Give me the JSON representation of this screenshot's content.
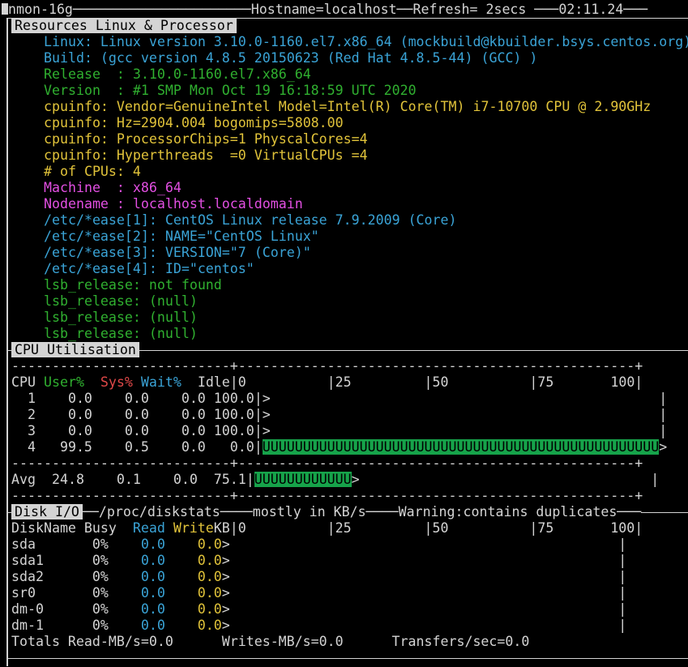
{
  "titlebar": {
    "app": "nmon-16g",
    "hostname": "Hostname=localhost",
    "refresh": "Refresh= 2secs",
    "clock": "02:11.24"
  },
  "resources": {
    "title": "Resources Linux & Processor",
    "linux": "Linux: Linux version 3.10.0-1160.el7.x86_64 (mockbuild@kbuilder.bsys.centos.org)",
    "build": "Build: (gcc version 4.8.5 20150623 (Red Hat 4.8.5-44) (GCC) )",
    "release": "Release  : 3.10.0-1160.el7.x86_64",
    "version": "Version  : #1 SMP Mon Oct 19 16:18:59 UTC 2020",
    "cpuinfo1": "cpuinfo: Vendor=GenuineIntel Model=Intel(R) Core(TM) i7-10700 CPU @ 2.90GHz",
    "cpuinfo2": "cpuinfo: Hz=2904.004 bogomips=5808.00",
    "cpuinfo3": "cpuinfo: ProcessorChips=1 PhyscalCores=4",
    "cpuinfo4": "cpuinfo: Hyperthreads  =0 VirtualCPUs =4",
    "ncpus": "# of CPUs: 4",
    "machine": "Machine  : x86_64",
    "nodename": "Nodename : localhost.localdomain",
    "ease1": "/etc/*ease[1]: CentOS Linux release 7.9.2009 (Core)",
    "ease2": "/etc/*ease[2]: NAME=\"CentOS Linux\"",
    "ease3": "/etc/*ease[3]: VERSION=\"7 (Core)\"",
    "ease4": "/etc/*ease[4]: ID=\"centos\"",
    "lsb1": "lsb_release: not found",
    "lsb2": "lsb_release: (null)",
    "lsb3": "lsb_release: (null)",
    "lsb4": "lsb_release: (null)"
  },
  "cpu": {
    "title": "CPU Utilisation",
    "ruler": "---------------------------+-------------------------------------------------+",
    "head_cpu": "CPU",
    "head_user": "User%",
    "head_sys": "Sys%",
    "head_wait": "Wait%",
    "head_idle": "Idle|0          |25         |50          |75       100|",
    "rows": [
      {
        "cpu": "  1",
        "user": "  0.0",
        "sys": "  0.0",
        "wait": "  0.0",
        "idle": "100.0|",
        "bar": "",
        "tail": ">                                                |",
        "usage_percent": 0.0
      },
      {
        "cpu": "  2",
        "user": "  0.0",
        "sys": "  0.0",
        "wait": "  0.0",
        "idle": "100.0|",
        "bar": "",
        "tail": ">                                                |",
        "usage_percent": 0.0
      },
      {
        "cpu": "  3",
        "user": "  0.0",
        "sys": "  0.0",
        "wait": "  0.0",
        "idle": "100.0|",
        "bar": "",
        "tail": ">                                                |",
        "usage_percent": 0.0
      },
      {
        "cpu": "  4",
        "user": " 99.5",
        "sys": "  0.5",
        "wait": "  0.0",
        "idle": "  0.0|",
        "bar": "UUUUUUUUUUUUUUUUUUUUUUUUUUUUUUUUUUUUUUUUUUUUUUUUU",
        "tail": ">",
        "usage_percent": 100.0
      }
    ],
    "avg": {
      "label": "Avg",
      "user": " 24.8",
      "sys": "  0.1",
      "wait": "  0.0",
      "idle": " 75.1|",
      "bar": "UUUUUUUUUUUU",
      "tail": ">                                    |",
      "usage_percent": 24.9
    }
  },
  "disk": {
    "title": "Disk I/O",
    "path": "/proc/diskstats",
    "mostly": "mostly in KB/s",
    "warning": "Warning:contains duplicates",
    "head_name": "DiskName Busy",
    "head_read": "Read",
    "head_write": "Write",
    "head_rest": "KB|0          |25         |50          |75       100|",
    "rows": [
      {
        "name": "sda     ",
        "busy": "  0%",
        "read": "    0.0",
        "write": "    0.0",
        "tail": ">                                                |"
      },
      {
        "name": "sda1    ",
        "busy": "  0%",
        "read": "    0.0",
        "write": "    0.0",
        "tail": ">                                                |"
      },
      {
        "name": "sda2    ",
        "busy": "  0%",
        "read": "    0.0",
        "write": "    0.0",
        "tail": ">                                                |"
      },
      {
        "name": "sr0     ",
        "busy": "  0%",
        "read": "    0.0",
        "write": "    0.0",
        "tail": ">                                                |"
      },
      {
        "name": "dm-0    ",
        "busy": "  0%",
        "read": "    0.0",
        "write": "    0.0",
        "tail": ">                                                |"
      },
      {
        "name": "dm-1    ",
        "busy": "  0%",
        "read": "    0.0",
        "write": "    0.0",
        "tail": ">                                                |"
      }
    ],
    "totals": "Totals Read-MB/s=0.0      Writes-MB/s=0.0      Transfers/sec=0.0"
  },
  "colors": {
    "cyan": "#3aa3d6",
    "green": "#30b030",
    "yellow": "#e1c33a",
    "magenta": "#e24fe2",
    "red": "#e04848",
    "bar": "#16a34a"
  }
}
